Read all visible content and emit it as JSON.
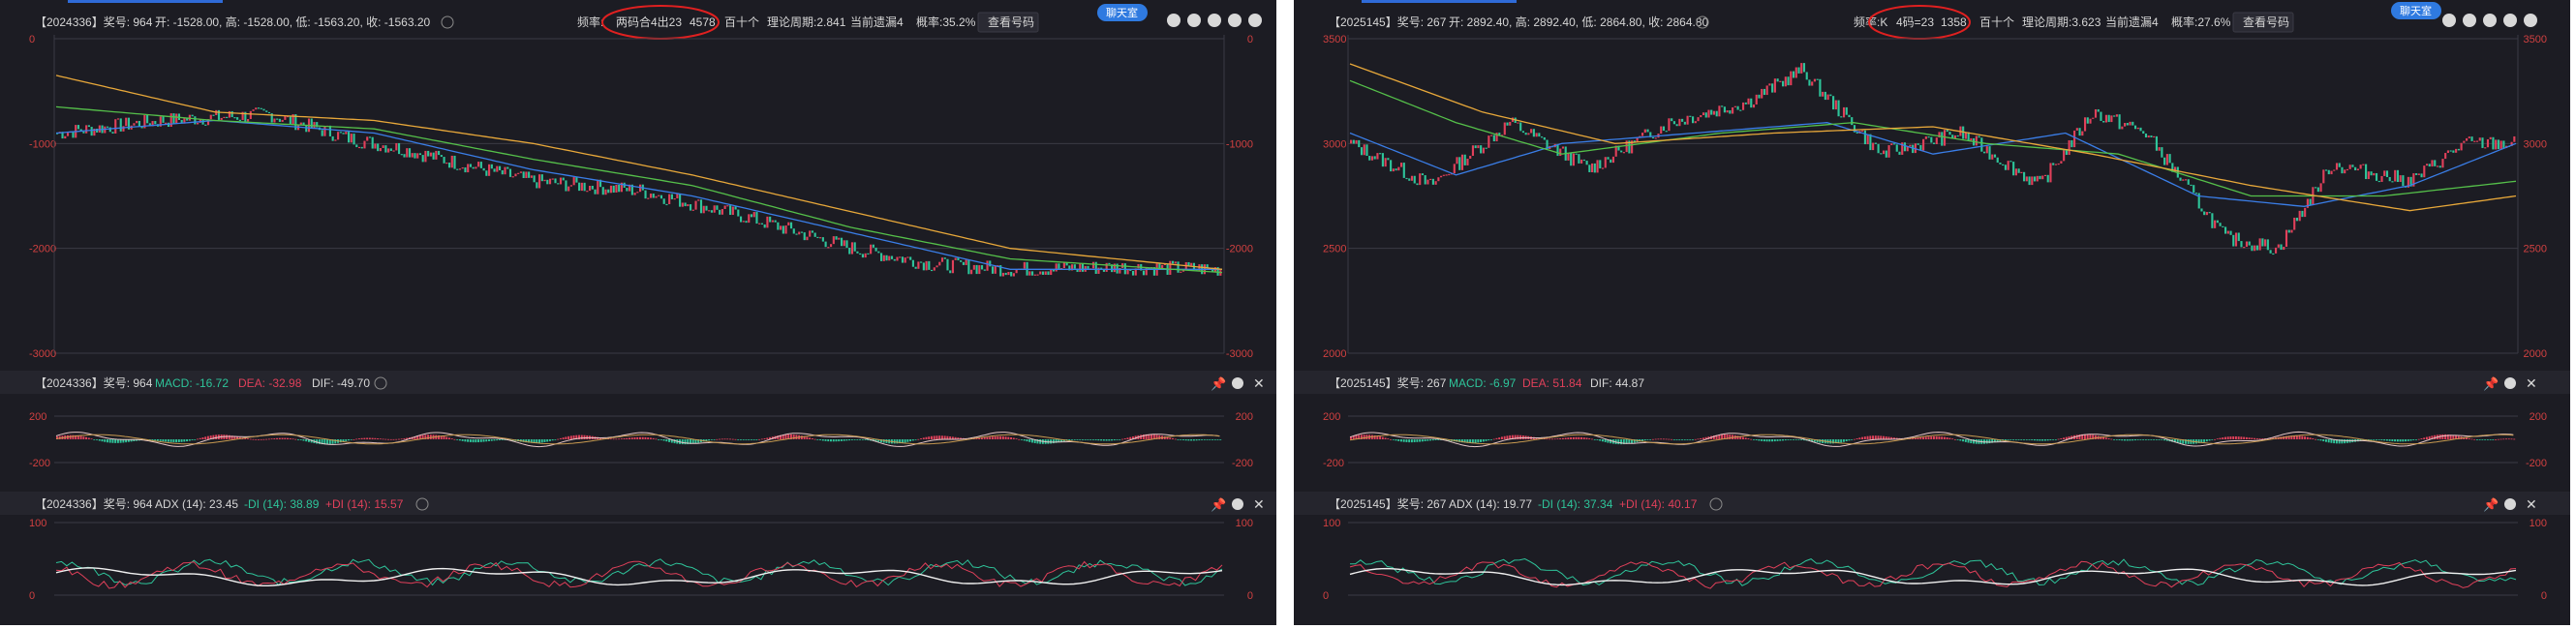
{
  "panels": [
    {
      "id": "left",
      "header": {
        "title": "【2024336】奖号: 964",
        "ohlc": "开: -1528.00, 高: -1528.00, 低: -1563.20, 收: -1563.20",
        "freq_label": "频率:",
        "freq_value": "两码合4出23",
        "count": "4578",
        "period": "百十个",
        "theory": "理论周期:2.841",
        "current": "当前遗漏4",
        "prob": "概率:35.2%",
        "lookup_btn": "查看号码",
        "chat_btn": "聊天室"
      },
      "macd_header": {
        "title": "【2024336】奖号: 964",
        "macd": "MACD: -16.72",
        "dea": "DEA: -32.98",
        "dif": "DIF: -49.70"
      },
      "adx_header": {
        "title": "【2024336】奖号: 964",
        "adx": "ADX (14): 23.45",
        "minus_di": "-DI (14): 38.89",
        "plus_di": "+DI (14): 15.57"
      }
    },
    {
      "id": "right",
      "header": {
        "title": "【2025145】奖号: 267",
        "ohlc": "开: 2892.40, 高: 2892.40, 低: 2864.80, 收: 2864.80",
        "freq_label": "频率:K",
        "freq_value": "4码=23",
        "count": "1358",
        "period": "百十个",
        "theory": "理论周期:3.623",
        "current": "当前遗漏4",
        "prob": "概率:27.6%",
        "lookup_btn": "查看号码",
        "chat_btn": "聊天室"
      },
      "macd_header": {
        "title": "【2025145】奖号: 267",
        "macd": "MACD: -6.97",
        "dea": "DEA: 51.84",
        "dif": "DIF: 44.87"
      },
      "adx_header": {
        "title": "【2025145】奖号: 267",
        "adx": "ADX (14): 19.77",
        "minus_di": "-DI (14): 37.34",
        "plus_di": "+DI (14): 40.17"
      }
    }
  ],
  "colors": {
    "background": "#1c1c23",
    "up": "#e0405a",
    "down": "#2ec49a",
    "ma_short": "#3a7ee8",
    "ma_mid": "#55c04a",
    "ma_long": "#e8a83a",
    "macd_dif": "#e8c8c8",
    "macd_dea": "#c89a50",
    "adx": "#f0f0f0",
    "annotation": "#e02020"
  },
  "chart_data": [
    {
      "type": "candlestick",
      "panel": "left",
      "y_ticks": [
        0,
        -1000,
        -2000,
        -3000
      ],
      "ylim": [
        -3000,
        0
      ],
      "close_anchors": [
        [
          0,
          -900
        ],
        [
          40,
          -780
        ],
        [
          80,
          -720
        ],
        [
          110,
          -950
        ],
        [
          130,
          -1050
        ],
        [
          150,
          -1180
        ],
        [
          180,
          -1360
        ],
        [
          220,
          -1450
        ],
        [
          260,
          -1700
        ],
        [
          300,
          -2000
        ],
        [
          330,
          -2150
        ],
        [
          360,
          -2200
        ],
        [
          400,
          -2180
        ],
        [
          440,
          -2200
        ]
      ],
      "ma_short_anchors": [
        [
          0,
          -900
        ],
        [
          60,
          -780
        ],
        [
          120,
          -900
        ],
        [
          180,
          -1250
        ],
        [
          240,
          -1500
        ],
        [
          300,
          -1850
        ],
        [
          360,
          -2200
        ],
        [
          440,
          -2200
        ]
      ],
      "ma_mid_anchors": [
        [
          0,
          -650
        ],
        [
          60,
          -780
        ],
        [
          120,
          -860
        ],
        [
          180,
          -1150
        ],
        [
          240,
          -1400
        ],
        [
          300,
          -1800
        ],
        [
          360,
          -2100
        ],
        [
          440,
          -2230
        ]
      ],
      "ma_long_anchors": [
        [
          0,
          -350
        ],
        [
          60,
          -700
        ],
        [
          120,
          -780
        ],
        [
          180,
          -1000
        ],
        [
          240,
          -1300
        ],
        [
          300,
          -1650
        ],
        [
          360,
          -2000
        ],
        [
          440,
          -2200
        ]
      ],
      "macd": {
        "ylim": [
          -300,
          300
        ],
        "y_ticks": [
          200,
          -200
        ]
      },
      "adx": {
        "ylim": [
          0,
          100
        ],
        "y_ticks": [
          100,
          0
        ]
      }
    },
    {
      "type": "candlestick",
      "panel": "right",
      "y_ticks": [
        3500,
        3000,
        2500,
        2000
      ],
      "ylim": [
        2000,
        3500
      ],
      "close_anchors": [
        [
          0,
          3000
        ],
        [
          30,
          2800
        ],
        [
          60,
          3100
        ],
        [
          90,
          2880
        ],
        [
          120,
          3100
        ],
        [
          150,
          3200
        ],
        [
          170,
          3350
        ],
        [
          200,
          2950
        ],
        [
          230,
          3050
        ],
        [
          260,
          2800
        ],
        [
          280,
          3150
        ],
        [
          300,
          3050
        ],
        [
          330,
          2550
        ],
        [
          350,
          2500
        ],
        [
          370,
          2900
        ],
        [
          400,
          2820
        ],
        [
          420,
          3000
        ],
        [
          440,
          3000
        ]
      ],
      "ma_short_anchors": [
        [
          0,
          3050
        ],
        [
          40,
          2850
        ],
        [
          80,
          3000
        ],
        [
          130,
          3050
        ],
        [
          180,
          3100
        ],
        [
          220,
          2950
        ],
        [
          270,
          3050
        ],
        [
          320,
          2750
        ],
        [
          360,
          2700
        ],
        [
          400,
          2800
        ],
        [
          440,
          3000
        ]
      ],
      "ma_mid_anchors": [
        [
          0,
          3300
        ],
        [
          40,
          3100
        ],
        [
          80,
          2950
        ],
        [
          140,
          3050
        ],
        [
          190,
          3100
        ],
        [
          240,
          3000
        ],
        [
          290,
          2950
        ],
        [
          340,
          2750
        ],
        [
          390,
          2750
        ],
        [
          440,
          2820
        ]
      ],
      "ma_long_anchors": [
        [
          0,
          3380
        ],
        [
          50,
          3150
        ],
        [
          100,
          3000
        ],
        [
          160,
          3050
        ],
        [
          220,
          3080
        ],
        [
          280,
          2950
        ],
        [
          340,
          2800
        ],
        [
          400,
          2680
        ],
        [
          440,
          2750
        ]
      ],
      "macd": {
        "ylim": [
          -300,
          300
        ],
        "y_ticks": [
          200,
          -200
        ]
      },
      "adx": {
        "ylim": [
          0,
          100
        ],
        "y_ticks": [
          100,
          0
        ]
      }
    }
  ]
}
